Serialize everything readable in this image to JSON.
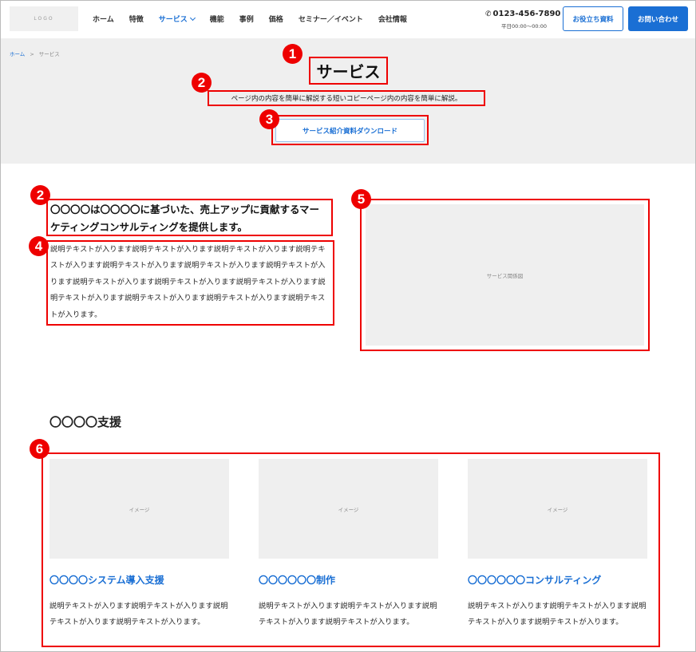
{
  "header": {
    "logo": "LOGO",
    "nav": [
      {
        "label": "ホーム"
      },
      {
        "label": "特徴"
      },
      {
        "label": "サービス"
      },
      {
        "label": "機能"
      },
      {
        "label": "事例"
      },
      {
        "label": "価格"
      },
      {
        "label": "セミナー／イベント"
      },
      {
        "label": "会社情報"
      }
    ],
    "phone": "0123-456-7890",
    "hours": "平日00:00〜00:00",
    "resources_button": "お役立ち資料",
    "contact_button": "お問い合わせ",
    "accent_color": "#1a6fd4"
  },
  "breadcrumb": {
    "home": "ホーム",
    "separator": ">",
    "current": "サービス"
  },
  "hero": {
    "title": "サービス",
    "lead": "ページ内の内容を簡単に解説する短いコピーページ内の内容を簡単に解説。",
    "download_button": "サービス紹介資料ダウンロード"
  },
  "badges": [
    "1",
    "2",
    "3",
    "2",
    "4",
    "5",
    "6"
  ],
  "intro": {
    "heading": "〇〇〇〇は〇〇〇〇に基づいた、売上アップに貢献するマーケティングコンサルティングを提供します。",
    "text": "説明テキストが入ります説明テキストが入ります説明テキストが入ります説明テキストが入ります説明テキストが入ります説明テキストが入ります説明テキストが入ります説明テキストが入ります説明テキストが入ります説明テキストが入ります説明テキストが入ります説明テキストが入ります説明テキストが入ります説明テキストが入ります。",
    "diagram_label": "サービス関係図"
  },
  "support": {
    "title": "〇〇〇〇支援",
    "cards": [
      {
        "image_label": "イメージ",
        "title": "〇〇〇〇システム導入支援",
        "text": "説明テキストが入ります説明テキストが入ります説明テキストが入ります説明テキストが入ります。"
      },
      {
        "image_label": "イメージ",
        "title": "〇〇〇〇〇〇制作",
        "text": "説明テキストが入ります説明テキストが入ります説明テキストが入ります説明テキストが入ります。"
      },
      {
        "image_label": "イメージ",
        "title": "〇〇〇〇〇〇コンサルティング",
        "text": "説明テキストが入ります説明テキストが入ります説明テキストが入ります説明テキストが入ります。"
      }
    ]
  },
  "annotation_color": "#e00000"
}
